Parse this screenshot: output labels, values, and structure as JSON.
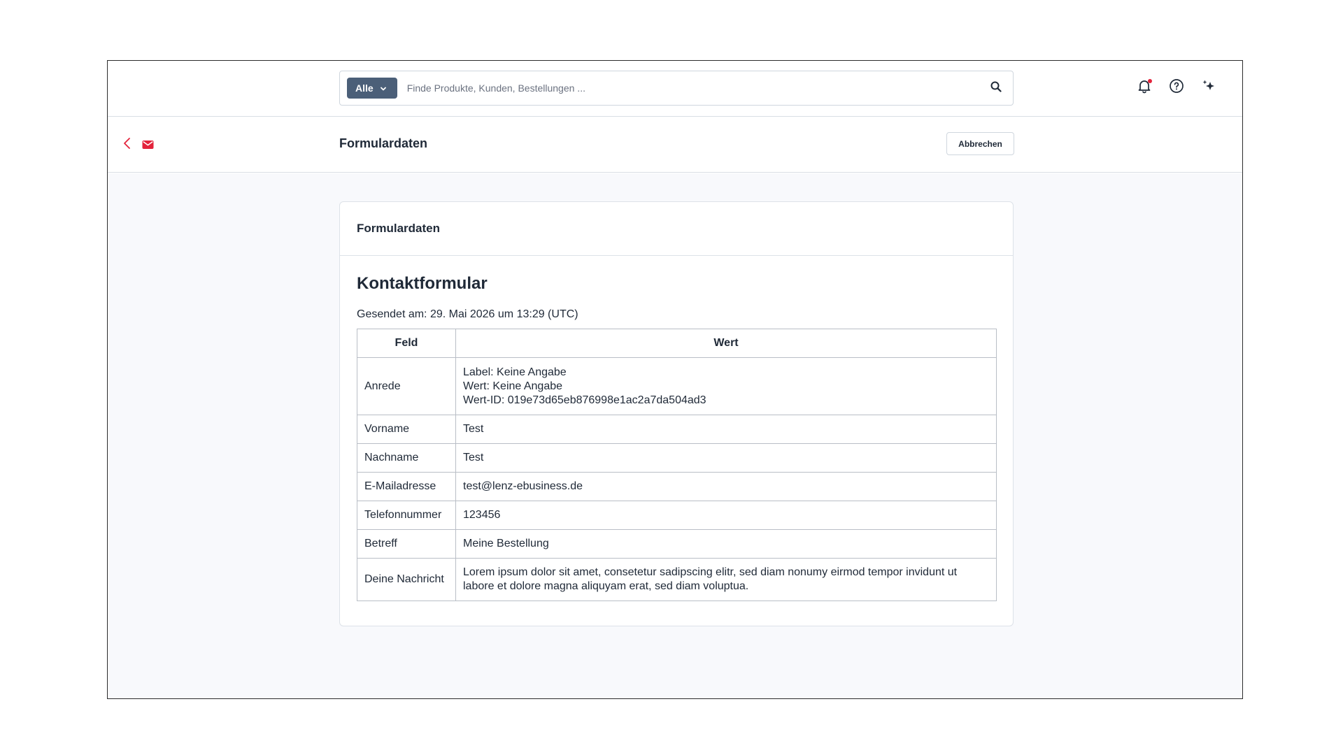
{
  "search": {
    "scope_label": "Alle",
    "placeholder": "Finde Produkte, Kunden, Bestellungen ..."
  },
  "header": {
    "title": "Formulardaten",
    "cancel_label": "Abbrechen"
  },
  "card": {
    "title": "Formulardaten",
    "form_heading": "Kontaktformular",
    "sent_at": "Gesendet am: 29. Mai 2026 um 13:29 (UTC)",
    "table": {
      "headers": {
        "field": "Feld",
        "value": "Wert"
      },
      "rows": [
        {
          "field": "Anrede",
          "lines": [
            "Label: Keine Angabe",
            "Wert: Keine Angabe",
            "Wert-ID: 019e73d65eb876998e1ac2a7da504ad3"
          ]
        },
        {
          "field": "Vorname",
          "value": "Test"
        },
        {
          "field": "Nachname",
          "value": "Test"
        },
        {
          "field": "E-Mailadresse",
          "value": "test@lenz-ebusiness.de"
        },
        {
          "field": "Telefonnummer",
          "value": "123456"
        },
        {
          "field": "Betreff",
          "value": "Meine Bestellung"
        },
        {
          "field": "Deine Nachricht",
          "value": "Lorem ipsum dolor sit amet, consetetur sadipscing elitr, sed diam nonumy eirmod tempor invidunt ut labore et dolore magna aliquyam erat, sed diam voluptua."
        }
      ]
    }
  },
  "icons": {
    "search": "search-icon",
    "bell": "bell-icon",
    "help": "help-icon",
    "ai": "sparkles-icon",
    "back": "chevron-left-icon",
    "mail": "mail-icon",
    "dropdown": "chevron-down-icon"
  },
  "colors": {
    "accent": "#e3233b",
    "scope_button": "#4b5f78",
    "content_bg": "#f8f9fc"
  }
}
